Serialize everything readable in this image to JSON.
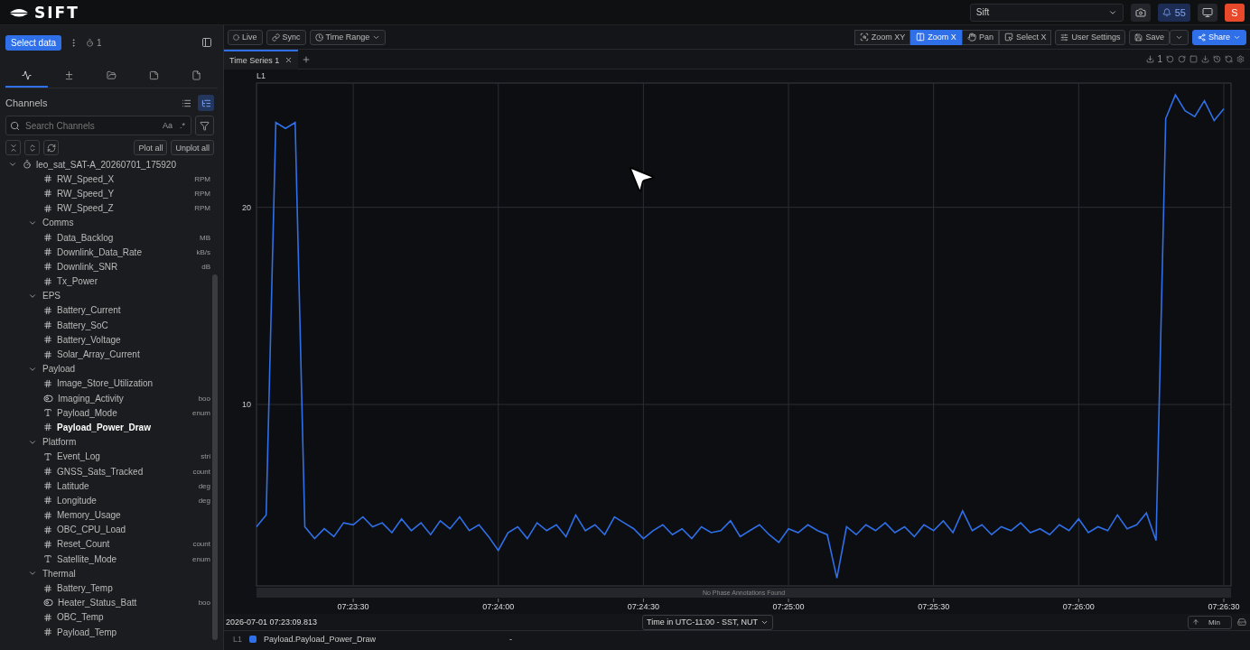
{
  "header": {
    "logo": "SIFT",
    "org_select": "Sift",
    "notifications": "55",
    "avatar": "S"
  },
  "sidebar": {
    "select_button": "Select data",
    "run_count": "1",
    "tabs": [
      {
        "kind": "signal",
        "selected": true
      },
      {
        "kind": "signal_plus",
        "selected": false
      },
      {
        "kind": "folder",
        "selected": false
      },
      {
        "kind": "note",
        "selected": false
      },
      {
        "kind": "file",
        "selected": false
      }
    ],
    "title": "Channels",
    "views": [
      {
        "kind": "list",
        "selected": false
      },
      {
        "kind": "tree",
        "selected": true
      }
    ],
    "search": {
      "placeholder": "Search Channels",
      "case_toggle": "Aa",
      "regex_toggle": ".*"
    },
    "plot_all": "Plot all",
    "unplot_all": "Unplot all",
    "tree": {
      "label": "leo_sat_SAT-A_20260701_175920",
      "expanded": true,
      "children": [
        {
          "kind": "number",
          "name": "RW_Speed_X",
          "unit": "RPM",
          "selected": false
        },
        {
          "kind": "number",
          "name": "RW_Speed_Y",
          "unit": "RPM",
          "selected": false
        },
        {
          "kind": "number",
          "name": "RW_Speed_Z",
          "unit": "RPM",
          "selected": false
        },
        {
          "kind": "group",
          "name": "Comms",
          "expanded": true,
          "children": [
            {
              "kind": "number",
              "name": "Data_Backlog",
              "unit": "MB",
              "selected": false
            },
            {
              "kind": "number",
              "name": "Downlink_Data_Rate",
              "unit": "kB/s",
              "selected": false
            },
            {
              "kind": "number",
              "name": "Downlink_SNR",
              "unit": "dB",
              "selected": false
            },
            {
              "kind": "number",
              "name": "Tx_Power",
              "selected": false
            }
          ]
        },
        {
          "kind": "group",
          "name": "EPS",
          "expanded": true,
          "children": [
            {
              "kind": "number",
              "name": "Battery_Current",
              "selected": false
            },
            {
              "kind": "number",
              "name": "Battery_SoC",
              "selected": false
            },
            {
              "kind": "number",
              "name": "Battery_Voltage",
              "selected": false
            },
            {
              "kind": "number",
              "name": "Solar_Array_Current",
              "selected": false
            }
          ]
        },
        {
          "kind": "group",
          "name": "Payload",
          "expanded": true,
          "children": [
            {
              "kind": "number",
              "name": "Image_Store_Utilization",
              "selected": false
            },
            {
              "kind": "bool",
              "name": "Imaging_Activity",
              "unit": "boo",
              "selected": false
            },
            {
              "kind": "string",
              "name": "Payload_Mode",
              "unit": "enum",
              "selected": false
            },
            {
              "kind": "number",
              "name": "Payload_Power_Draw",
              "selected": true
            }
          ]
        },
        {
          "kind": "group",
          "name": "Platform",
          "expanded": true,
          "children": [
            {
              "kind": "string",
              "name": "Event_Log",
              "unit": "stri",
              "selected": false
            },
            {
              "kind": "number",
              "name": "GNSS_Sats_Tracked",
              "unit": "count",
              "selected": false
            },
            {
              "kind": "number",
              "name": "Latitude",
              "unit": "deg",
              "selected": false
            },
            {
              "kind": "number",
              "name": "Longitude",
              "unit": "deg",
              "selected": false
            },
            {
              "kind": "number",
              "name": "Memory_Usage",
              "selected": false
            },
            {
              "kind": "number",
              "name": "OBC_CPU_Load",
              "selected": false
            },
            {
              "kind": "number",
              "name": "Reset_Count",
              "unit": "count",
              "selected": false
            },
            {
              "kind": "string",
              "name": "Satellite_Mode",
              "unit": "enum",
              "selected": false
            }
          ]
        },
        {
          "kind": "group",
          "name": "Thermal",
          "expanded": true,
          "children": [
            {
              "kind": "number",
              "name": "Battery_Temp",
              "selected": false
            },
            {
              "kind": "bool",
              "name": "Heater_Status_Batt",
              "unit": "boo",
              "selected": false
            },
            {
              "kind": "number",
              "name": "OBC_Temp",
              "selected": false
            },
            {
              "kind": "number",
              "name": "Payload_Temp",
              "selected": false
            }
          ]
        }
      ]
    }
  },
  "toolbar": {
    "left": [
      {
        "kind": "live",
        "label": "Live"
      },
      {
        "kind": "sync",
        "label": "Sync"
      },
      {
        "kind": "time",
        "label": "Time Range"
      }
    ],
    "modes": [
      {
        "kind": "zoom_xy",
        "label": "Zoom XY",
        "selected": false
      },
      {
        "kind": "zoom_x",
        "label": "Zoom X",
        "selected": true
      },
      {
        "kind": "pan",
        "label": "Pan",
        "selected": false
      },
      {
        "kind": "select_x",
        "label": "Select X",
        "selected": false
      }
    ],
    "settings": "User Settings",
    "save": "Save",
    "share": "Share"
  },
  "tabs": [
    {
      "label": "Time Series 1",
      "selected": true
    }
  ],
  "tab_tools": {
    "download_count": "1"
  },
  "plot": {
    "axis_label": "L1",
    "annotations_note": "No Phase Annotations Found",
    "start_time": "2026-07-01 07:23:09.813",
    "timezone": "Time in UTC-11:00 - SST, NUT",
    "aggregate": "Min",
    "chart_data": {
      "type": "line",
      "grid": true,
      "xlim": [
        26590,
        26791.5
      ],
      "ylim": [
        0.8,
        26.3
      ],
      "xticks": [
        {
          "value": 26610,
          "label": "07:23:30"
        },
        {
          "value": 26640,
          "label": "07:24:00"
        },
        {
          "value": 26670,
          "label": "07:24:30"
        },
        {
          "value": 26700,
          "label": "07:25:00"
        },
        {
          "value": 26730,
          "label": "07:25:30"
        },
        {
          "value": 26760,
          "label": "07:26:00"
        },
        {
          "value": 26790,
          "label": "07:26:30"
        }
      ],
      "yticks": [
        10,
        20
      ],
      "x": [
        26590,
        26592,
        26594,
        26596,
        26598,
        26600,
        26602,
        26604,
        26606,
        26608,
        26610,
        26612,
        26614,
        26616,
        26618,
        26620,
        26622,
        26624,
        26626,
        26628,
        26630,
        26632,
        26634,
        26636,
        26638,
        26640,
        26642,
        26644,
        26646,
        26648,
        26650,
        26652,
        26654,
        26656,
        26658,
        26660,
        26662,
        26664,
        26666,
        26668,
        26670,
        26672,
        26674,
        26676,
        26678,
        26680,
        26682,
        26684,
        26686,
        26688,
        26690,
        26692,
        26694,
        26696,
        26698,
        26700,
        26702,
        26704,
        26706,
        26708,
        26710,
        26712,
        26714,
        26716,
        26718,
        26720,
        26722,
        26724,
        26726,
        26728,
        26730,
        26732,
        26734,
        26736,
        26738,
        26740,
        26742,
        26744,
        26746,
        26748,
        26750,
        26752,
        26754,
        26756,
        26758,
        26760,
        26762,
        26764,
        26766,
        26768,
        26770,
        26772,
        26774,
        26776,
        26778,
        26780,
        26782,
        26784,
        26786,
        26788,
        26790
      ],
      "series": [
        {
          "color": "#2f6fe8",
          "values": [
            3.8,
            4.4,
            24.3,
            24.0,
            24.3,
            3.8,
            3.2,
            3.7,
            3.3,
            4.0,
            3.9,
            4.3,
            3.8,
            4.0,
            3.5,
            4.2,
            3.6,
            4.0,
            3.4,
            4.1,
            3.7,
            4.3,
            3.6,
            3.9,
            3.3,
            2.6,
            3.5,
            3.8,
            3.2,
            4.0,
            3.6,
            3.9,
            3.3,
            4.4,
            3.6,
            3.9,
            3.4,
            4.3,
            4.0,
            3.7,
            3.2,
            3.6,
            3.9,
            3.4,
            3.7,
            3.2,
            3.8,
            3.5,
            3.6,
            4.1,
            3.3,
            3.6,
            3.9,
            3.4,
            3.0,
            3.7,
            3.5,
            3.9,
            3.6,
            3.4,
            1.2,
            3.8,
            3.4,
            3.9,
            3.6,
            4.0,
            3.5,
            3.8,
            3.3,
            3.9,
            3.6,
            4.1,
            3.5,
            4.6,
            3.6,
            3.9,
            3.4,
            3.8,
            3.6,
            4.0,
            3.5,
            3.7,
            3.4,
            3.9,
            3.6,
            4.2,
            3.5,
            3.8,
            3.6,
            4.4,
            3.7,
            3.9,
            4.5,
            3.1,
            24.5,
            25.7,
            24.9,
            24.6,
            25.4,
            24.4,
            25.0
          ]
        }
      ]
    }
  },
  "legend": [
    {
      "axis": "L1",
      "name": "Payload.Payload_Power_Draw",
      "value": "-"
    }
  ]
}
